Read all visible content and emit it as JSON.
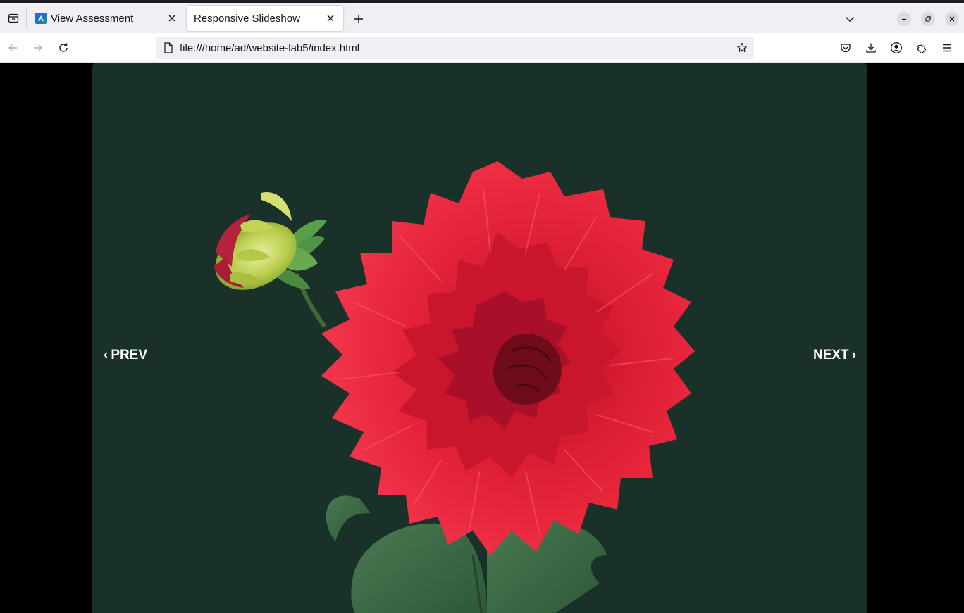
{
  "browser": {
    "tabs": [
      {
        "label": "View Assessment",
        "active": false,
        "favicon": "app-logo-icon"
      },
      {
        "label": "Responsive Slideshow",
        "active": true
      }
    ],
    "url": "file:///home/ad/website-lab5/index.html"
  },
  "slideshow": {
    "prev_label": "PREV",
    "next_label": "NEXT",
    "prev_chevron": "‹",
    "next_chevron": "›",
    "background_color": "#1a3129",
    "image_subject": "red-dahlia-flower"
  }
}
